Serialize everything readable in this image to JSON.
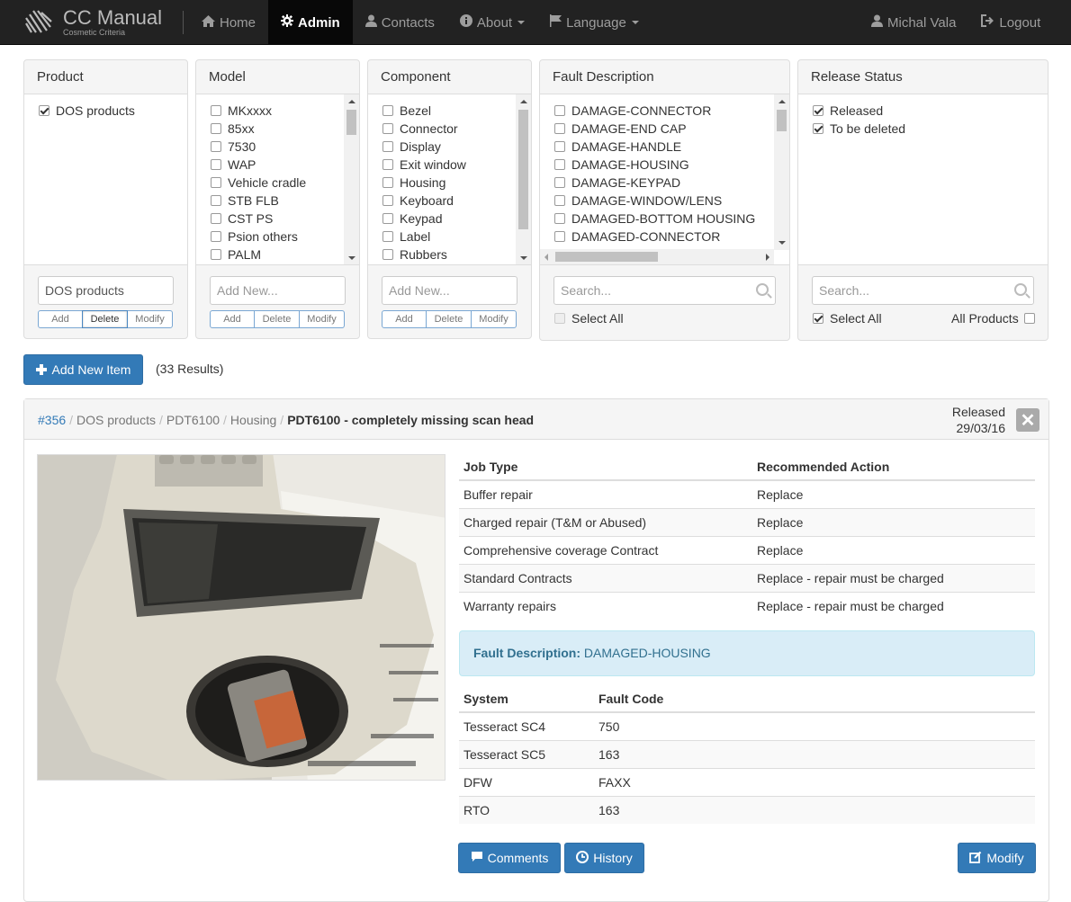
{
  "navbar": {
    "brand_title": "CC Manual",
    "brand_subtitle": "Cosmetic Criteria",
    "items": [
      {
        "label": "Home",
        "icon": "home-icon"
      },
      {
        "label": "Admin",
        "icon": "gear-icon"
      },
      {
        "label": "Contacts",
        "icon": "user-icon"
      },
      {
        "label": "About",
        "icon": "info-icon"
      },
      {
        "label": "Language",
        "icon": "flag-icon"
      }
    ],
    "user": "Michal Vala",
    "logout": "Logout"
  },
  "filters": {
    "product": {
      "title": "Product",
      "items": [
        {
          "label": "DOS products",
          "checked": true
        }
      ],
      "input_value": "DOS products",
      "buttons": [
        "Add",
        "Delete",
        "Modify"
      ]
    },
    "model": {
      "title": "Model",
      "items": [
        "MKxxxx",
        "85xx",
        "7530",
        "WAP",
        "Vehicle cradle",
        "STB FLB",
        "CST PS",
        "Psion others",
        "PALM"
      ],
      "input_placeholder": "Add New...",
      "buttons": [
        "Add",
        "Delete",
        "Modify"
      ]
    },
    "component": {
      "title": "Component",
      "items": [
        "Bezel",
        "Connector",
        "Display",
        "Exit window",
        "Housing",
        "Keyboard",
        "Keypad",
        "Label",
        "Rubbers"
      ],
      "input_placeholder": "Add New...",
      "buttons": [
        "Add",
        "Delete",
        "Modify"
      ]
    },
    "fault": {
      "title": "Fault Description",
      "items": [
        "DAMAGE-CONNECTOR",
        "DAMAGE-END CAP",
        "DAMAGE-HANDLE",
        "DAMAGE-HOUSING",
        "DAMAGE-KEYPAD",
        "DAMAGE-WINDOW/LENS",
        "DAMAGED-BOTTOM HOUSING",
        "DAMAGED-CONNECTOR"
      ],
      "search_placeholder": "Search...",
      "select_all": "Select All"
    },
    "release": {
      "title": "Release Status",
      "items": [
        {
          "label": "Released",
          "checked": true
        },
        {
          "label": "To be deleted",
          "checked": true
        }
      ],
      "search_placeholder": "Search...",
      "select_all": "Select All",
      "all_products": "All Products"
    }
  },
  "actions": {
    "add_new": "Add New Item",
    "results": "(33 Results)"
  },
  "item": {
    "id": "#356",
    "breadcrumb": [
      "DOS products",
      "PDT6100",
      "Housing"
    ],
    "title": "PDT6100 - completely missing scan head",
    "status": "Released",
    "date": "29/03/16",
    "job_table": {
      "headers": [
        "Job Type",
        "Recommended Action"
      ],
      "rows": [
        [
          "Buffer repair",
          "Replace"
        ],
        [
          "Charged repair (T&M or Abused)",
          "Replace"
        ],
        [
          "Comprehensive coverage Contract",
          "Replace"
        ],
        [
          "Standard Contracts",
          "Replace - repair must be charged"
        ],
        [
          "Warranty repairs",
          "Replace - repair must be charged"
        ]
      ]
    },
    "fault_label": "Fault Description:",
    "fault_value": "DAMAGED-HOUSING",
    "code_table": {
      "headers": [
        "System",
        "Fault Code"
      ],
      "rows": [
        [
          "Tesseract SC4",
          "750"
        ],
        [
          "Tesseract SC5",
          "163"
        ],
        [
          "DFW",
          "FAXX"
        ],
        [
          "RTO",
          "163"
        ]
      ]
    },
    "buttons": {
      "comments": "Comments",
      "history": "History",
      "modify": "Modify"
    }
  },
  "colors": {
    "primary": "#337ab7",
    "navbar": "#222222",
    "info_bg": "#d9edf7"
  }
}
